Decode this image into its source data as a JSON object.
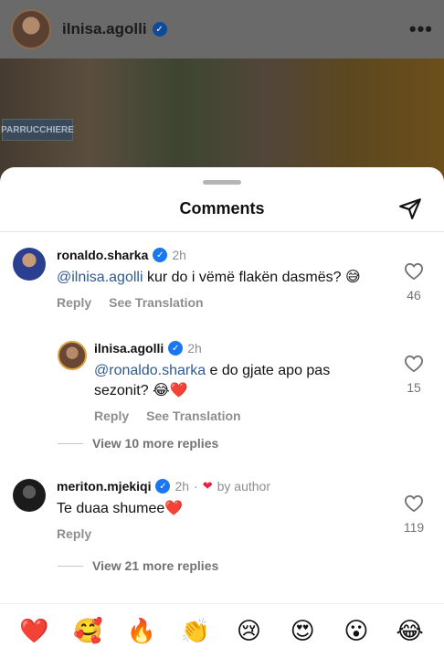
{
  "post": {
    "username": "ilnisa.agolli",
    "more": "•••",
    "sign_text": "PARRUCCHIERE"
  },
  "sheet": {
    "title": "Comments"
  },
  "comments": [
    {
      "username": "ronaldo.sharka",
      "time": "2h",
      "mention": "@ilnisa.agolli",
      "text": " kur do i vëmë flakën dasmës? 😅",
      "reply": "Reply",
      "see_translation": "See Translation",
      "likes": "46"
    },
    {
      "username": "ilnisa.agolli",
      "time": "2h",
      "mention": "@ronaldo.sharka",
      "text": " e do gjate apo pas sezonit? 😂❤️",
      "reply": "Reply",
      "see_translation": "See Translation",
      "likes": "15"
    },
    {
      "username": "meriton.mjekiqi",
      "time": "2h",
      "dot": "·",
      "by_author": "by author",
      "text": "Te duaa shumee❤️",
      "reply": "Reply",
      "likes": "119"
    }
  ],
  "view_more": [
    {
      "label": "View 10 more replies"
    },
    {
      "label": "View 21 more replies"
    }
  ],
  "emoji_bar": [
    "❤️",
    "🥰",
    "🔥",
    "👏",
    "😢",
    "😍",
    "😮",
    "😂"
  ],
  "colors": {
    "accent_blue": "#1a77f2",
    "mention": "#2f5b8f",
    "heart": "#ed2242"
  }
}
